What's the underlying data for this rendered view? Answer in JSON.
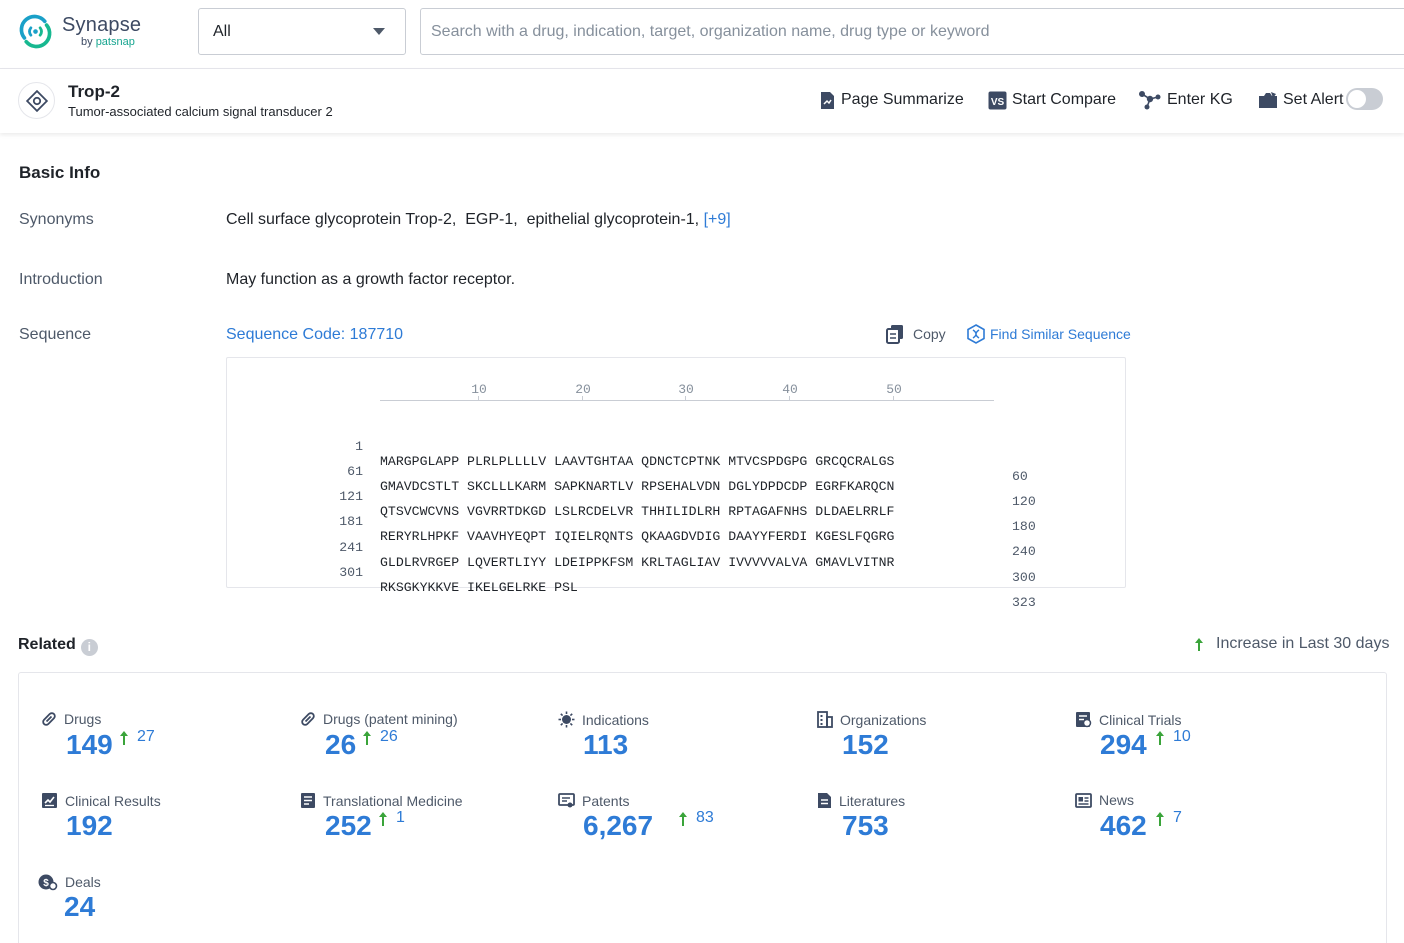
{
  "brand": {
    "name": "Synapse",
    "by": "by",
    "sub": "patsnap"
  },
  "search": {
    "scope": "All",
    "placeholder": "Search with a drug, indication, target, organization name, drug type or keyword"
  },
  "entity": {
    "title": "Trop-2",
    "subtitle": "Tumor-associated calcium signal transducer 2",
    "actions": {
      "summarize": "Page Summarize",
      "compare": "Start Compare",
      "kg": "Enter KG",
      "alert": "Set Alert"
    },
    "alert_enabled": false
  },
  "basic_info": {
    "title": "Basic Info",
    "synonyms_label": "Synonyms",
    "synonyms": "Cell surface glycoprotein Trop-2,  EGP-1,  epithelial glycoprotein-1,",
    "synonyms_more": "[+9]",
    "intro_label": "Introduction",
    "intro": "May function as a growth factor receptor.",
    "sequence_label": "Sequence",
    "sequence_code": "Sequence Code: 187710",
    "copy": "Copy",
    "find_similar": "Find Similar Sequence",
    "ruler": [
      "10",
      "20",
      "30",
      "40",
      "50"
    ],
    "rows": [
      {
        "start": "1",
        "seq": "MARGPGLAPP PLRLPLLLLV LAAVTGHTAA QDNCTCPTNK MTVCSPDGPG GRCQCRALGS",
        "end": "60"
      },
      {
        "start": "61",
        "seq": "GMAVDCSTLT SKCLLLKARM SAPKNARTLV RPSEHALVDN DGLYDPDCDP EGRFKARQCN",
        "end": "120"
      },
      {
        "start": "121",
        "seq": "QTSVCWCVNS VGVRRTDKGD LSLRCDELVR THHILIDLRH RPTAGAFNHS DLDAELRRLF",
        "end": "180"
      },
      {
        "start": "181",
        "seq": "RERYRLHPKF VAAVHYEQPT IQIELRQNTS QKAAGDVDIG DAAYYFERDI KGESLFQGRG",
        "end": "240"
      },
      {
        "start": "241",
        "seq": "GLDLRVRGEP LQVERTLIYY LDEIPPKFSM KRLTAGLIAV IVVVVVALVA GMAVLVITNR",
        "end": "300"
      },
      {
        "start": "301",
        "seq": "RKSGKYKKVE IKELGELRKE PSL",
        "end": "323"
      }
    ]
  },
  "related": {
    "title": "Related",
    "legend": "Increase in Last 30 days",
    "accent": "#2e7bd6",
    "increase_color": "#3aa43a",
    "stats": [
      {
        "label": "Drugs",
        "count": "149",
        "inc": "27",
        "icon": "pill-icon"
      },
      {
        "label": "Drugs (patent mining)",
        "count": "26",
        "inc": "26",
        "icon": "pill-icon"
      },
      {
        "label": "Indications",
        "count": "113",
        "inc": "",
        "icon": "virus-icon"
      },
      {
        "label": "Organizations",
        "count": "152",
        "inc": "",
        "icon": "building-icon"
      },
      {
        "label": "Clinical Trials",
        "count": "294",
        "inc": "10",
        "icon": "clinical-trials-icon"
      },
      {
        "label": "Clinical Results",
        "count": "192",
        "inc": "",
        "icon": "chart-doc-icon"
      },
      {
        "label": "Translational Medicine",
        "count": "252",
        "inc": "1",
        "icon": "doc-list-icon"
      },
      {
        "label": "Patents",
        "count": "6,267",
        "inc": "83",
        "icon": "patent-icon"
      },
      {
        "label": "Literatures",
        "count": "753",
        "inc": "",
        "icon": "literature-icon"
      },
      {
        "label": "News",
        "count": "462",
        "inc": "7",
        "icon": "news-icon"
      },
      {
        "label": "Deals",
        "count": "24",
        "inc": "",
        "icon": "deal-icon"
      }
    ]
  }
}
